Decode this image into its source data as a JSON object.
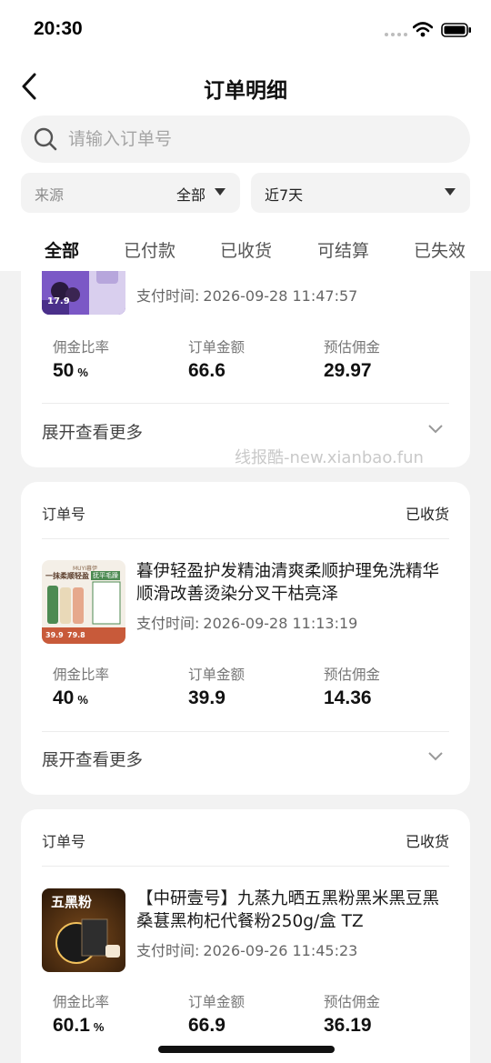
{
  "status_bar": {
    "time": "20:30"
  },
  "nav": {
    "title": "订单明细"
  },
  "search": {
    "placeholder": "请输入订单号"
  },
  "filters": {
    "source_label": "来源",
    "source_value": "全部",
    "period_value": "近7天"
  },
  "tabs": [
    "全部",
    "已付款",
    "已收货",
    "可结算",
    "已失效"
  ],
  "labels": {
    "pay_time": "支付时间:",
    "commission_rate": "佣金比率",
    "order_amount": "订单金额",
    "est_commission": "预估佣金",
    "expand_more": "展开查看更多",
    "order_no": "订单号"
  },
  "orders": [
    {
      "pay_time": "2026-09-28 11:47:57",
      "rate": "50",
      "rate_unit": "%",
      "amount": "66.6",
      "commission": "29.97",
      "thumb_price": "17.9"
    },
    {
      "status": "已收货",
      "title": "暮伊轻盈护发精油清爽柔顺护理免洗精华顺滑改善烫染分叉干枯亮泽",
      "pay_time": "2026-09-28 11:13:19",
      "rate": "40",
      "rate_unit": "%",
      "amount": "39.9",
      "commission": "14.36",
      "thumb_brand": "MUYI暮伊",
      "thumb_slogan": "一抹柔顺轻盈",
      "thumb_tag": "抚平毛躁",
      "thumb_prices": [
        "39.9",
        "79.8"
      ]
    },
    {
      "status": "已收货",
      "title": "【中研壹号】九蒸九晒五黑粉黑米黑豆黑桑葚黑枸杞代餐粉250g/盒 TZ",
      "pay_time": "2026-09-26 11:45:23",
      "rate": "60.1",
      "rate_unit": "%",
      "amount": "66.9",
      "commission": "36.19",
      "thumb_text": "五黑粉"
    }
  ],
  "watermark": "线报酷-new.xianbao.fun",
  "colors": {
    "accent_purple": "#6a3fb0",
    "thumb_brown": "#3a2410",
    "gold": "#f2c15c"
  }
}
